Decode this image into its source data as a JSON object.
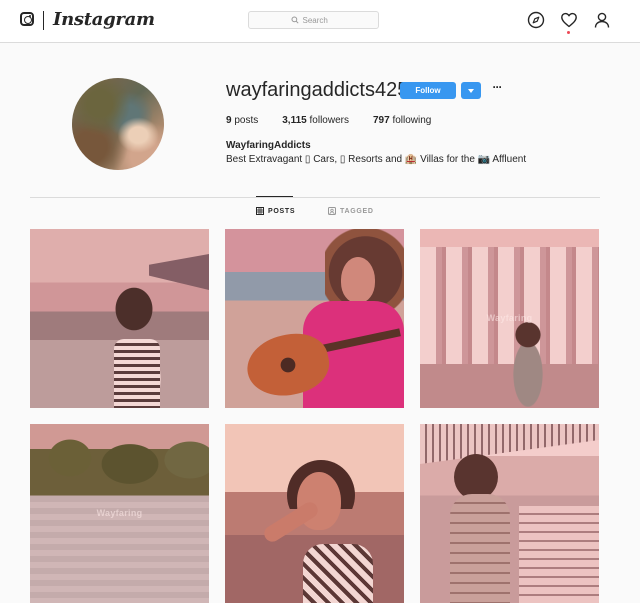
{
  "nav": {
    "wordmark": "Instagram",
    "search_placeholder": "Search",
    "icons": [
      "camera-icon",
      "compass-icon",
      "heart-icon",
      "user-icon",
      "search-icon"
    ]
  },
  "profile": {
    "username": "wayfaringaddicts42535",
    "follow_label": "Follow",
    "more_label": "···",
    "stats": {
      "posts_count": "9",
      "posts_label": "posts",
      "followers_count": "3,115",
      "followers_label": "followers",
      "following_count": "797",
      "following_label": "following"
    },
    "full_name": "WayfaringAddicts",
    "bio": "Best Extravagant ▯ Cars, ▯ Resorts and 🏨 Villas for the 📷 Affluent"
  },
  "tabs": {
    "posts": "POSTS",
    "tagged": "TAGGED"
  },
  "watermarks": {
    "tile3": "Wayfaring",
    "tile4": "Wayfaring"
  },
  "colors": {
    "accent": "#3897f0",
    "notification": "#ed4956",
    "text": "#262626",
    "muted": "#999999"
  }
}
